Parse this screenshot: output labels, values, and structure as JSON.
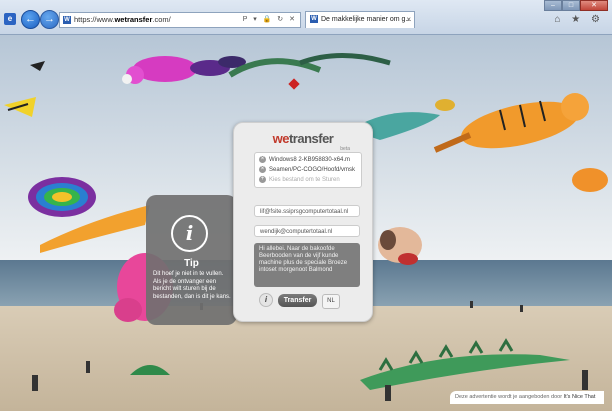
{
  "browser": {
    "url_prefix": "https://www.",
    "url_domain": "wetransfer",
    "url_suffix": ".com/",
    "address_tools": "P ▾ 🔒 ↻ ✕",
    "tab_title": "De makkelijke manier om g...",
    "tab_close": "×",
    "back_icon": "←",
    "forward_icon": "→",
    "right_icons": "⌂ ★ ⚙",
    "window_controls": [
      "–",
      "□",
      "✕"
    ]
  },
  "wetransfer": {
    "logo_we": "we",
    "logo_transfer": "transfer",
    "beta_label": "beta",
    "files": [
      {
        "icon": "×",
        "name": "Windows8 2-KB958830-x64.m"
      },
      {
        "icon": "×",
        "name": "Seamen/PC-COGO/Hoofd/vmsk"
      },
      {
        "icon": "+",
        "name": "Kies bestand om te Sturen"
      }
    ],
    "to_email": "lif@fsite.ssiprsgcomputertotaal.nl",
    "from_email": "wendijk@computertotaal.nl",
    "message": "Hi allebei. Naar de bakoofde Beerbooden van de vijf kunde machine plus de speciale Broeze intoset morgenoot Balmond",
    "info_label": "i",
    "transfer_label": "Transfer",
    "lang_label": "NL"
  },
  "tip": {
    "icon_label": "i",
    "title": "Tip",
    "text": "Dit hoef je niet in te vullen. Als je de ontvanger een bericht wilt sturen bij de bestanden, dan is dit je kans."
  },
  "ad": {
    "label": "Deze advertentie wordt je aangeboden door",
    "brand": "It's Nice That"
  },
  "colors": {
    "wetransfer_red": "#c1392b",
    "tip_bg": "#707070",
    "ie_blue": "#1d5fc0"
  }
}
